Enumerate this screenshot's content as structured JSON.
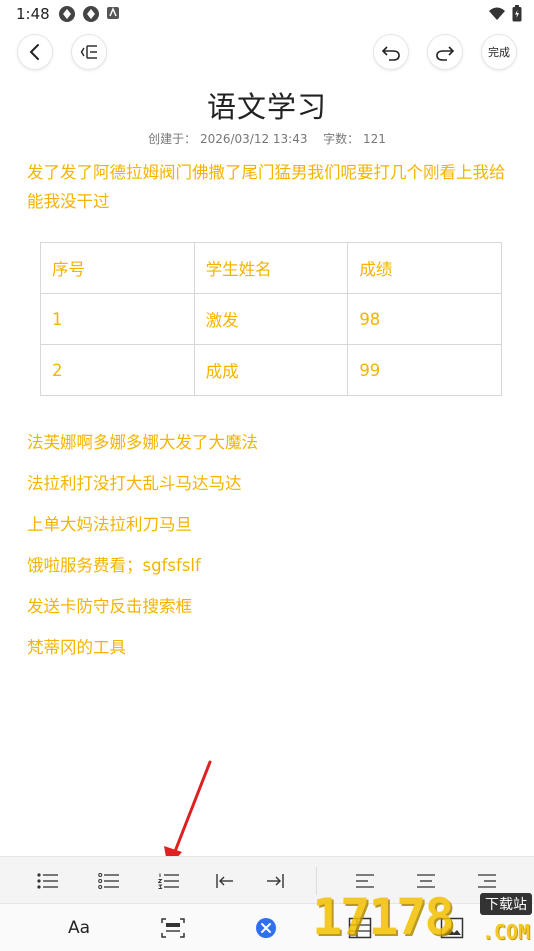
{
  "status_bar": {
    "time": "1:48"
  },
  "toolbar": {
    "done_label": "完成"
  },
  "document": {
    "title": "语文学习",
    "meta_created_label": "创建于：",
    "meta_created_value": "2026/03/12 13:43",
    "meta_words_label": "字数：",
    "meta_words_value": "121",
    "paragraph1": "发了发了阿德拉姆阀门佛撒了尾门猛男我们呢要打几个刚看上我给能我没干过",
    "table": {
      "header": [
        "序号",
        "学生姓名",
        "成绩"
      ],
      "rows": [
        [
          "1",
          "激发",
          "98"
        ],
        [
          "2",
          "成成",
          "99"
        ]
      ]
    },
    "lines": [
      "法芙娜啊多娜多娜大发了大魔法",
      "法拉利打没打大乱斗马达马达",
      "上单大妈法拉利刀马旦",
      "饿啦服务费看；sgfsfslf",
      "发送卡防守反击搜索框",
      "梵蒂冈的工具"
    ]
  },
  "bottom_bar": {
    "font_label": "Aa"
  },
  "watermark": {
    "number": "17178",
    "badge": "下载站",
    "suffix": ".COM"
  },
  "colors": {
    "content_text": "#f5b300",
    "accent_blue": "#2f6ff0"
  }
}
